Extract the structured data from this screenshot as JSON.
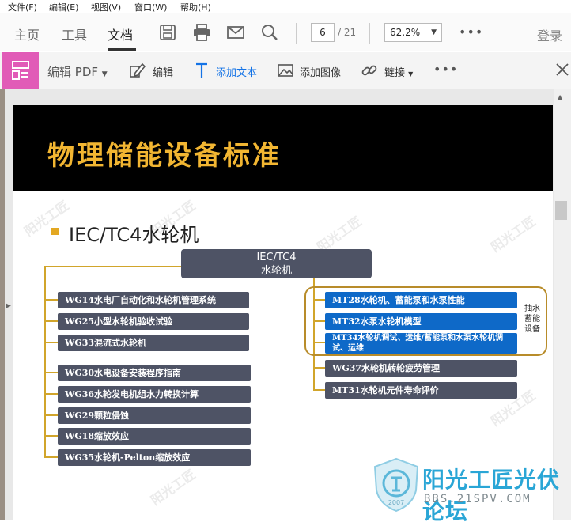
{
  "menu": [
    "文件(F)",
    "编辑(E)",
    "视图(V)",
    "窗口(W)",
    "帮助(H)"
  ],
  "toolbar": {
    "tabs": [
      "主页",
      "工具",
      "文档"
    ],
    "page_current": "6",
    "page_total": "/ 21",
    "zoom": "62.2%",
    "login": "登录",
    "more": "•••"
  },
  "edit_toolbar": {
    "title": "编辑 PDF",
    "edit": "编辑",
    "add_text": "添加文本",
    "add_image": "添加图像",
    "link": "链接",
    "more": "•••"
  },
  "slide": {
    "title": "物理储能设备标准",
    "bullet": "IEC/TC4水轮机",
    "root_line1": "IEC/TC4",
    "root_line2": "水轮机",
    "left_items": [
      "WG14水电厂自动化和水轮机管理系统",
      "WG25小型水轮机验收试验",
      "WG33混流式水轮机",
      "WG30水电设备安装程序指南",
      "WG36水轮发电机组水力转换计算",
      "WG29颗粒侵蚀",
      "WG18缩放效应",
      "WG35水轮机-Pelton缩放效应"
    ],
    "right_blue_items": [
      "MT28水轮机、蓄能泵和水泵性能",
      "MT32水泵水轮机模型",
      "MT34水轮机调试、运维/蓄能泵和水泵水轮机调试、运维"
    ],
    "right_gray_items": [
      "WG37水轮机转轮疲劳管理",
      "MT31水轮机元件寿命评价"
    ],
    "side_label": "抽水蓄能设备"
  },
  "watermark": {
    "brand": "阳光工匠光伏论坛",
    "url": "BBS.21SPV.COM",
    "year": "2007"
  },
  "colors": {
    "title_gold": "#f2b632",
    "line_gold": "#d1a52b",
    "box_gray": "#4e5365",
    "box_blue": "#0e69c8",
    "edit_accent": "#e15bb7",
    "link_blue": "#1473e6"
  }
}
